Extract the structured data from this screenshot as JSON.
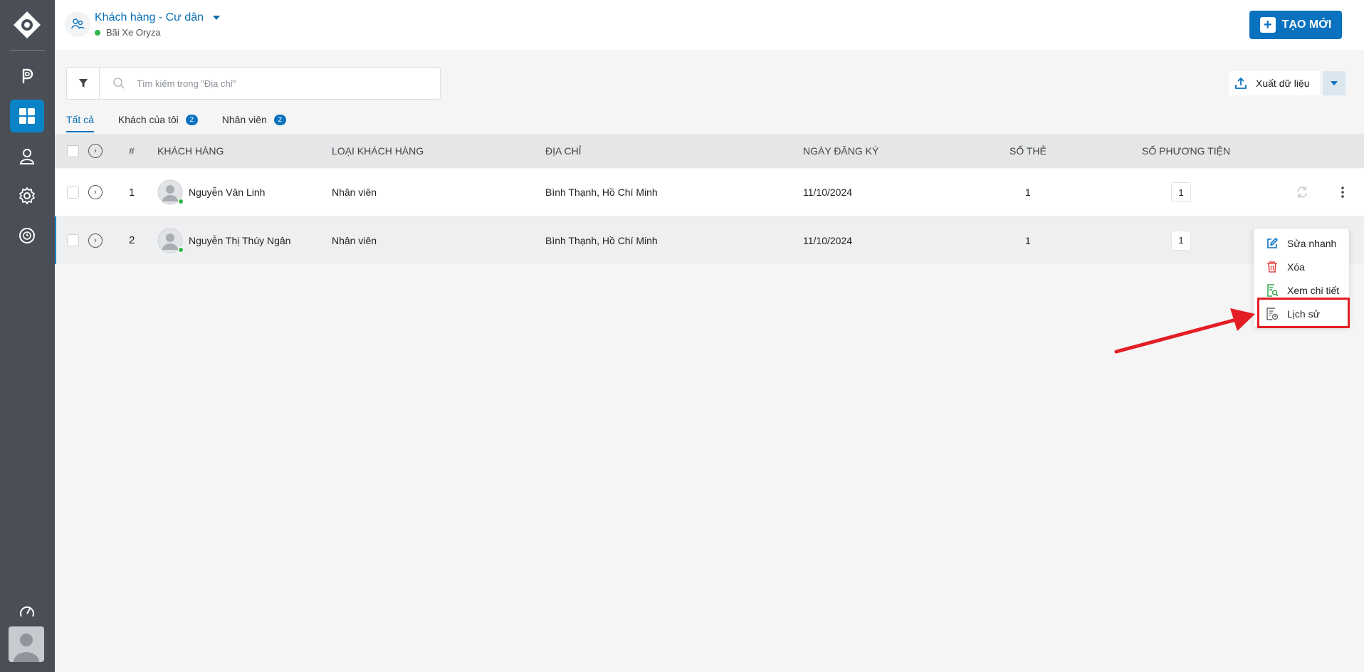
{
  "sidebar": {
    "items": [
      {
        "icon": "parking-icon"
      },
      {
        "icon": "dashboard-grid-icon",
        "active": true
      },
      {
        "icon": "user-icon"
      },
      {
        "icon": "settings-icon"
      },
      {
        "icon": "history-clock-icon"
      }
    ],
    "bottom_icon": "speed-gauge-icon"
  },
  "header": {
    "title": "Khách hàng - Cư dân",
    "subtitle": "Bãi Xe Oryza",
    "create_label": "TẠO MỚI"
  },
  "toolbar": {
    "search_placeholder": "Tìm kiếm trong \"Địa chỉ\"",
    "export_label": "Xuất dữ liệu"
  },
  "tabs": [
    {
      "label": "Tất cả",
      "active": true
    },
    {
      "label": "Khách của tôi",
      "count": "2"
    },
    {
      "label": "Nhân viên",
      "count": "2"
    }
  ],
  "table": {
    "columns": [
      "#",
      "KHÁCH HÀNG",
      "LOẠI KHÁCH HÀNG",
      "ĐỊA CHỈ",
      "NGÀY ĐĂNG KÝ",
      "SỐ THẺ",
      "SỐ PHƯƠNG TIỆN"
    ],
    "rows": [
      {
        "index": "1",
        "name": "Nguyễn Văn Linh",
        "type": "Nhân viên",
        "address": "Bình Thạnh, Hồ Chí Minh",
        "date": "11/10/2024",
        "cards": "1",
        "vehicles": "1"
      },
      {
        "index": "2",
        "name": "Nguyễn Thị Thúy Ngân",
        "type": "Nhân viên",
        "address": "Bình Thạnh, Hồ Chí Minh",
        "date": "11/10/2024",
        "cards": "1",
        "vehicles": "1"
      }
    ]
  },
  "context_menu": {
    "items": [
      {
        "label": "Sửa nhanh",
        "icon": "edit-icon",
        "color": "#0a72bf"
      },
      {
        "label": "Xóa",
        "icon": "trash-icon",
        "color": "#e34848"
      },
      {
        "label": "Xem chi tiết",
        "icon": "view-detail-icon",
        "color": "#2fa84f"
      },
      {
        "label": "Lịch sử",
        "icon": "history-doc-icon",
        "color": "#666666"
      }
    ]
  },
  "colors": {
    "primary": "#0a72bf",
    "sidebar": "#4a4f57",
    "highlight": "#e31e24",
    "online": "#2fb54a"
  }
}
